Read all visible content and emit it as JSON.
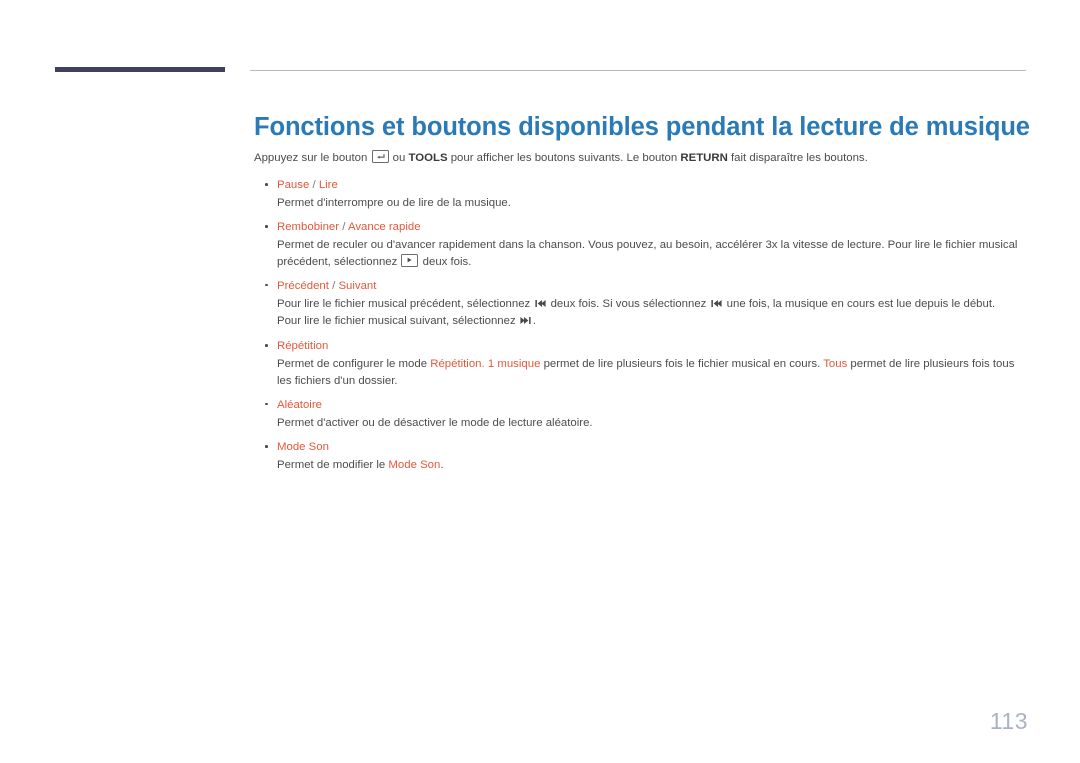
{
  "document": {
    "page_title": "Fonctions et boutons disponibles pendant la lecture de musique",
    "page_number": "113",
    "title_color": "#2a7ab8",
    "accent_color": "#e2583b",
    "body_color": "#4c4c4c",
    "corner_bar_color": "#3f3f5f",
    "page_number_color": "#a8b4c2"
  },
  "intro": {
    "part1": "Appuyez sur le bouton ",
    "enter_icon": "enter-key-icon",
    "part2": " ou ",
    "tools_label": "TOOLS",
    "part3": " pour afficher les boutons suivants. Le bouton ",
    "return_label": "RETURN",
    "part4": " fait disparaître les boutons."
  },
  "items": [
    {
      "title_a": "Pause",
      "separator": " / ",
      "title_b": "Lire",
      "body": "Permet d'interrompre ou de lire de la musique."
    },
    {
      "title_a": "Rembobiner",
      "separator": " / ",
      "title_b": "Avance rapide",
      "body_part1": "Permet de reculer ou d'avancer rapidement dans la chanson. Vous pouvez, au besoin, accélérer 3x la vitesse de lecture. Pour lire le fichier musical précédent, sélectionnez ",
      "play_icon": "play-key-icon",
      "body_part2": " deux fois."
    },
    {
      "title_a": "Précédent",
      "separator": " / ",
      "title_b": "Suivant",
      "body_part1": "Pour lire le fichier musical précédent, sélectionnez ",
      "prev_icon": "previous-track-icon",
      "body_part2": " deux fois. Si vous sélectionnez ",
      "prev_icon2": "previous-track-icon",
      "body_part3": " une fois, la musique en cours est lue depuis le début.",
      "body_part4": "Pour lire le fichier musical suivant, sélectionnez ",
      "next_icon": "next-track-icon",
      "body_part5": "."
    },
    {
      "title_a": "Répétition",
      "body_part1": "Permet de configurer le mode ",
      "hl1": "Répétition",
      "body_part2": ". ",
      "hl2": "1 musique",
      "body_part3": " permet de lire plusieurs fois le fichier musical en cours. ",
      "hl3": "Tous",
      "body_part4": " permet de lire plusieurs fois tous les fichiers d'un dossier."
    },
    {
      "title_a": "Aléatoire",
      "body": "Permet d'activer ou de désactiver le mode de lecture aléatoire."
    },
    {
      "title_a": "Mode Son",
      "body_part1": "Permet de modifier le ",
      "hl1": "Mode Son",
      "body_part2": "."
    }
  ]
}
